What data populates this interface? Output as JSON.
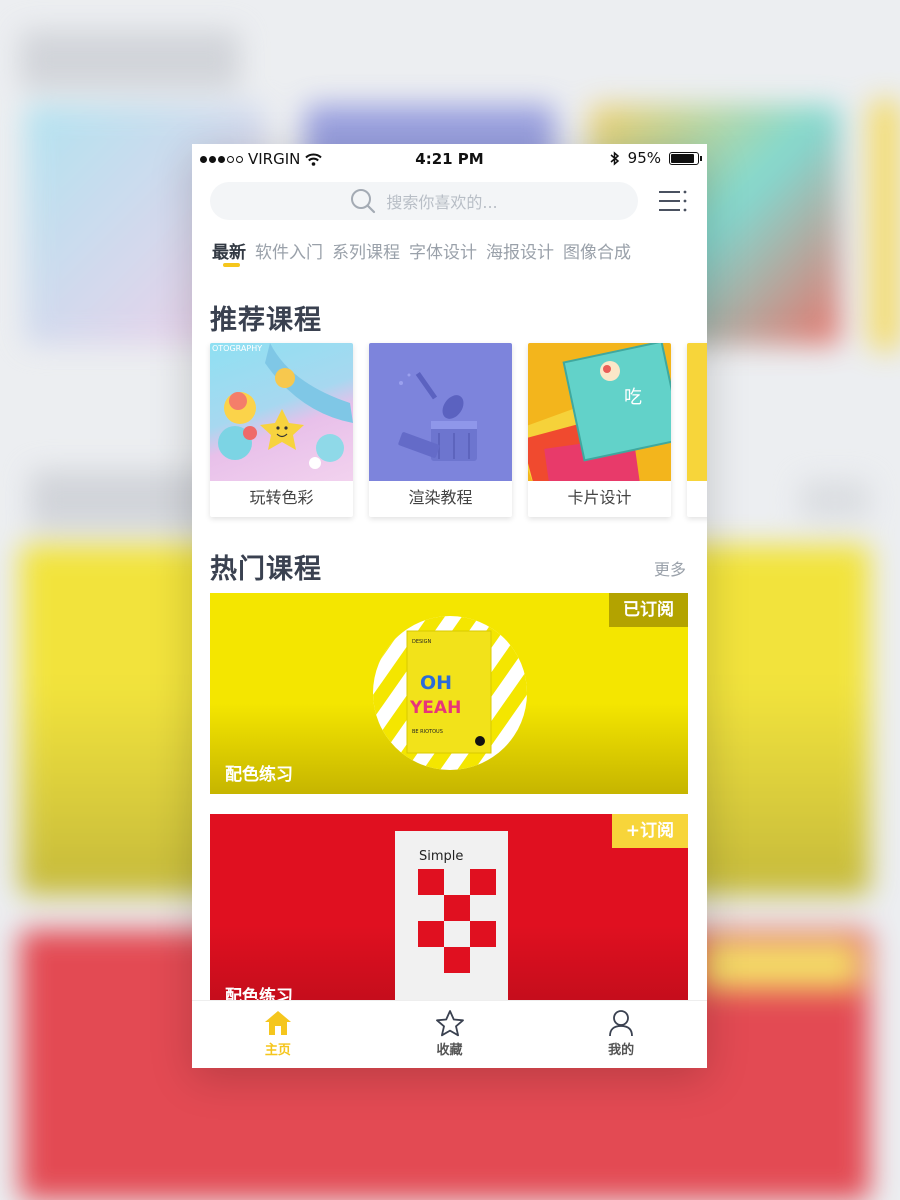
{
  "status_bar": {
    "carrier": "VIRGIN",
    "time": "4:21 PM",
    "battery": "95%",
    "battery_level": 0.95,
    "icons": [
      "signal-dots-icon",
      "wifi-icon",
      "bluetooth-icon",
      "battery-icon"
    ]
  },
  "search": {
    "placeholder": "搜索你喜欢的...",
    "icon": "search-icon",
    "menu_icon": "list-menu-icon"
  },
  "tabs": [
    {
      "label": "最新",
      "active": true
    },
    {
      "label": "软件入门",
      "active": false
    },
    {
      "label": "系列课程",
      "active": false
    },
    {
      "label": "字体设计",
      "active": false
    },
    {
      "label": "海报设计",
      "active": false
    },
    {
      "label": "图像合成",
      "active": false
    }
  ],
  "recommended": {
    "title": "推荐课程",
    "cards": [
      {
        "label": "玩转色彩",
        "image_text": "OTOGRAPHY"
      },
      {
        "label": "渲染教程"
      },
      {
        "label": "卡片设计",
        "image_text": "吃"
      }
    ]
  },
  "hot": {
    "title": "热门课程",
    "more": "更多",
    "cards": [
      {
        "label": "配色练习",
        "badge": "已订阅",
        "poster_line1": "OH",
        "poster_line2": "YEAH",
        "poster_top": "DESIGN",
        "poster_bottom": "BE RIOTOUS",
        "accent": "#f4e200"
      },
      {
        "label": "配色练习",
        "badge": "+订阅",
        "poster_title": "Simple",
        "accent": "#e01020"
      }
    ]
  },
  "tab_bar": [
    {
      "label": "主页",
      "icon": "home-icon",
      "active": true
    },
    {
      "label": "收藏",
      "icon": "star-icon",
      "active": false
    },
    {
      "label": "我的",
      "icon": "user-icon",
      "active": false
    }
  ],
  "colors": {
    "accent": "#f5c61d",
    "text_dark": "#3a4150",
    "text_muted": "#9aa1aa"
  }
}
